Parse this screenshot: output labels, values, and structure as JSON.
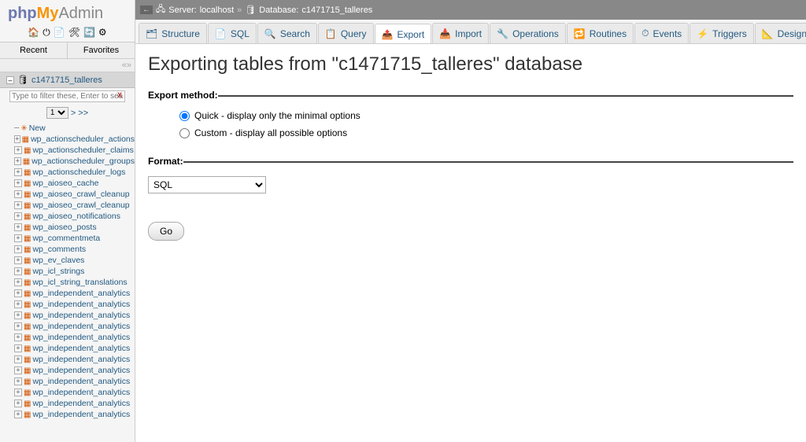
{
  "logo": {
    "php": "php",
    "my": "My",
    "admin": "Admin"
  },
  "sidebar_icons": [
    "🏠",
    "⏻",
    "📄",
    "🛠",
    "🔄",
    "⚙"
  ],
  "sidebar_tabs": {
    "recent": "Recent",
    "favorites": "Favorites"
  },
  "collapse_glyph": "«»",
  "db_name": "c1471715_talleres",
  "filter_placeholder": "Type to filter these, Enter to search",
  "page_sel": "1",
  "page_nav": "> >>",
  "tree_new": "New",
  "tree": [
    "wp_actionscheduler_actions",
    "wp_actionscheduler_claims",
    "wp_actionscheduler_groups",
    "wp_actionscheduler_logs",
    "wp_aioseo_cache",
    "wp_aioseo_crawl_cleanup",
    "wp_aioseo_crawl_cleanup",
    "wp_aioseo_notifications",
    "wp_aioseo_posts",
    "wp_commentmeta",
    "wp_comments",
    "wp_ev_claves",
    "wp_icl_strings",
    "wp_icl_string_translations",
    "wp_independent_analytics",
    "wp_independent_analytics",
    "wp_independent_analytics",
    "wp_independent_analytics",
    "wp_independent_analytics",
    "wp_independent_analytics",
    "wp_independent_analytics",
    "wp_independent_analytics",
    "wp_independent_analytics",
    "wp_independent_analytics",
    "wp_independent_analytics",
    "wp_independent_analytics"
  ],
  "breadcrumb": {
    "server_label": "Server:",
    "server_value": "localhost",
    "db_label": "Database:",
    "db_value": "c1471715_talleres",
    "sep": " » "
  },
  "tabs": [
    {
      "icon": "🗂",
      "label": "Structure"
    },
    {
      "icon": "📄",
      "label": "SQL"
    },
    {
      "icon": "🔍",
      "label": "Search"
    },
    {
      "icon": "📋",
      "label": "Query"
    },
    {
      "icon": "📤",
      "label": "Export"
    },
    {
      "icon": "📥",
      "label": "Import"
    },
    {
      "icon": "🔧",
      "label": "Operations"
    },
    {
      "icon": "🔁",
      "label": "Routines"
    },
    {
      "icon": "⏱",
      "label": "Events"
    },
    {
      "icon": "⚡",
      "label": "Triggers"
    },
    {
      "icon": "📐",
      "label": "Designer"
    }
  ],
  "active_tab": 4,
  "page_heading": "Exporting tables from \"c1471715_talleres\" database",
  "section": {
    "export_method": "Export method:",
    "format": "Format:"
  },
  "radios": {
    "quick": "Quick - display only the minimal options",
    "custom": "Custom - display all possible options"
  },
  "format_value": "SQL",
  "go_label": "Go"
}
